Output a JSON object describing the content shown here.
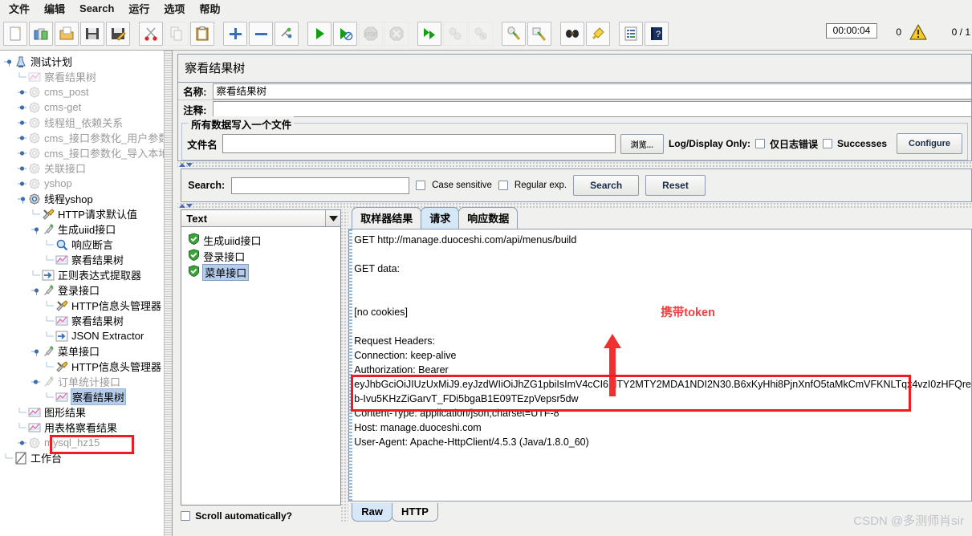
{
  "menu": {
    "items": [
      {
        "label": "文件",
        "name": "menu-file"
      },
      {
        "label": "编辑",
        "name": "menu-edit"
      },
      {
        "label": "Search",
        "name": "menu-search"
      },
      {
        "label": "运行",
        "name": "menu-run"
      },
      {
        "label": "选项",
        "name": "menu-options"
      },
      {
        "label": "帮助",
        "name": "menu-help"
      }
    ]
  },
  "toolbar": {
    "icons": [
      {
        "name": "new-icon",
        "group": 1,
        "disabled": false
      },
      {
        "name": "templates-icon",
        "group": 1,
        "disabled": false
      },
      {
        "name": "open-icon",
        "group": 1,
        "disabled": false
      },
      {
        "name": "save-icon",
        "group": 1,
        "disabled": false
      },
      {
        "name": "save-as-icon",
        "group": 1,
        "disabled": false
      },
      {
        "name": "cut-icon",
        "group": 2,
        "disabled": false
      },
      {
        "name": "copy-icon",
        "group": 2,
        "disabled": true
      },
      {
        "name": "paste-icon",
        "group": 2,
        "disabled": false
      },
      {
        "name": "expand-all-icon",
        "group": 3,
        "disabled": false
      },
      {
        "name": "collapse-all-icon",
        "group": 3,
        "disabled": false
      },
      {
        "name": "toggle-icon",
        "group": 3,
        "disabled": false
      },
      {
        "name": "start-icon",
        "group": 4,
        "disabled": false
      },
      {
        "name": "start-no-pause-icon",
        "group": 4,
        "disabled": false
      },
      {
        "name": "stop-icon",
        "group": 4,
        "disabled": true
      },
      {
        "name": "shutdown-icon",
        "group": 4,
        "disabled": true
      },
      {
        "name": "remote-start-all-icon",
        "group": 5,
        "disabled": false
      },
      {
        "name": "remote-stop-all-icon",
        "group": 5,
        "disabled": true
      },
      {
        "name": "remote-shutdown-all-icon",
        "group": 5,
        "disabled": true
      },
      {
        "name": "clear-icon",
        "group": 6,
        "disabled": false
      },
      {
        "name": "clear-all-icon",
        "group": 6,
        "disabled": false
      },
      {
        "name": "search-icon",
        "group": 7,
        "disabled": false
      },
      {
        "name": "search-reset-icon",
        "group": 7,
        "disabled": false
      },
      {
        "name": "function-helper-icon",
        "group": 8,
        "disabled": false
      },
      {
        "name": "help-icon",
        "group": 8,
        "disabled": false
      }
    ],
    "timer": "00:00:04",
    "warn_count": "0",
    "thread_count": "0 / 1"
  },
  "tree": {
    "nodes": [
      {
        "label": "测试计划",
        "indent": 0,
        "icon": "test-plan-icon",
        "handle": "expanded",
        "dim": false
      },
      {
        "label": "察看结果树",
        "indent": 1,
        "icon": "view-results-tree-icon",
        "handle": "leaf",
        "dim": true
      },
      {
        "label": "cms_post",
        "indent": 1,
        "icon": "thread-group-icon",
        "handle": "collapsed",
        "dim": true
      },
      {
        "label": "cms-get",
        "indent": 1,
        "icon": "thread-group-icon",
        "handle": "collapsed",
        "dim": true
      },
      {
        "label": "线程组_依赖关系",
        "indent": 1,
        "icon": "thread-group-icon",
        "handle": "collapsed",
        "dim": true
      },
      {
        "label": "cms_接口参数化_用户参数",
        "indent": 1,
        "icon": "thread-group-icon",
        "handle": "collapsed",
        "dim": true
      },
      {
        "label": "cms_接口参数化_导入本地文件",
        "indent": 1,
        "icon": "thread-group-icon",
        "handle": "collapsed",
        "dim": true
      },
      {
        "label": "关联接口",
        "indent": 1,
        "icon": "thread-group-icon",
        "handle": "collapsed",
        "dim": true
      },
      {
        "label": "yshop",
        "indent": 1,
        "icon": "thread-group-icon",
        "handle": "collapsed",
        "dim": true
      },
      {
        "label": "线程yshop",
        "indent": 1,
        "icon": "thread-group-active-icon",
        "handle": "expanded",
        "dim": false
      },
      {
        "label": "HTTP请求默认值",
        "indent": 2,
        "icon": "http-defaults-icon",
        "handle": "leaf",
        "dim": false
      },
      {
        "label": "生成uiid接口",
        "indent": 2,
        "icon": "http-sampler-icon",
        "handle": "expanded",
        "dim": false
      },
      {
        "label": "响应断言",
        "indent": 3,
        "icon": "assertion-icon",
        "handle": "leaf",
        "dim": false
      },
      {
        "label": "察看结果树",
        "indent": 3,
        "icon": "view-results-tree-icon",
        "handle": "leaf",
        "dim": false
      },
      {
        "label": "正则表达式提取器",
        "indent": 2,
        "icon": "regex-extractor-icon",
        "handle": "leaf",
        "dim": false
      },
      {
        "label": "登录接口",
        "indent": 2,
        "icon": "http-sampler-icon",
        "handle": "expanded",
        "dim": false
      },
      {
        "label": "HTTP信息头管理器",
        "indent": 3,
        "icon": "http-header-manager-icon",
        "handle": "leaf",
        "dim": false
      },
      {
        "label": "察看结果树",
        "indent": 3,
        "icon": "view-results-tree-icon",
        "handle": "leaf",
        "dim": false
      },
      {
        "label": "JSON Extractor",
        "indent": 3,
        "icon": "regex-extractor-icon",
        "handle": "leaf",
        "dim": false
      },
      {
        "label": "菜单接口",
        "indent": 2,
        "icon": "http-sampler-icon",
        "handle": "expanded",
        "dim": false
      },
      {
        "label": "HTTP信息头管理器",
        "indent": 3,
        "icon": "http-header-manager-icon",
        "handle": "leaf",
        "dim": false
      },
      {
        "label": "订单统计接口",
        "indent": 2,
        "icon": "http-sampler-icon",
        "handle": "collapsed",
        "dim": true
      },
      {
        "label": "察看结果树",
        "indent": 3,
        "icon": "view-results-tree-icon",
        "handle": "leaf",
        "dim": false,
        "selected": true
      },
      {
        "label": "图形结果",
        "indent": 1,
        "icon": "view-results-tree-icon",
        "handle": "leaf",
        "dim": false
      },
      {
        "label": "用表格察看结果",
        "indent": 1,
        "icon": "view-results-tree-icon",
        "handle": "leaf",
        "dim": false
      },
      {
        "label": "mysql_hz15",
        "indent": 1,
        "icon": "thread-group-icon",
        "handle": "collapsed",
        "dim": true
      },
      {
        "label": "工作台",
        "indent": 0,
        "icon": "workbench-icon",
        "handle": "leaf",
        "dim": false
      }
    ]
  },
  "panel": {
    "title": "察看结果树",
    "name_label": "名称:",
    "name_value": "察看结果树",
    "comment_label": "注释:",
    "comment_value": "",
    "group_title": "所有数据写入一个文件",
    "filename_label": "文件名",
    "filename_value": "",
    "browse_button": "浏览...",
    "log_display_label": "Log/Display Only:",
    "errors_only_label": "仅日志错误",
    "successes_label": "Successes",
    "configure_button": "Configure"
  },
  "search": {
    "label": "Search:",
    "value": "",
    "case_sensitive_label": "Case sensitive",
    "regular_exp_label": "Regular exp.",
    "search_button": "Search",
    "reset_button": "Reset"
  },
  "results": {
    "render_selected": "Text",
    "items": [
      {
        "label": "生成uiid接口",
        "status": "success",
        "selected": false
      },
      {
        "label": "登录接口",
        "status": "success",
        "selected": false
      },
      {
        "label": "菜单接口",
        "status": "success",
        "selected": true
      }
    ],
    "scroll_label": "Scroll automatically?"
  },
  "detail": {
    "tabs": [
      {
        "label": "取样器结果",
        "active": false
      },
      {
        "label": "请求",
        "active": true
      },
      {
        "label": "响应数据",
        "active": false
      }
    ],
    "bottom_tabs": [
      {
        "label": "Raw",
        "active": true
      },
      {
        "label": "HTTP",
        "active": false
      }
    ],
    "lines": [
      "GET http://manage.duoceshi.com/api/menus/build",
      "",
      "GET data:",
      "",
      "",
      "[no cookies]",
      "",
      "Request Headers:",
      "Connection: keep-alive",
      "Authorization: Bearer"
    ],
    "token_line_1": "eyJhbGciOiJIUzUxMiJ9.eyJzdWIiOiJhZG1pbiIsImV4cCI6MTY2MTY2MDA1NDI2N30.B6xKyHhi8PjnXnfO5taMkCmVFKNLTqx4vzI0zHFQre",
    "token_line_2": "b-Ivu5KHzZiGarvT_FDi5bgaB1E09TEzpVepsr5dw",
    "lines_after": [
      "Content-Type: application/json;charset=UTF-8",
      "Host: manage.duoceshi.com",
      "User-Agent: Apache-HttpClient/4.5.3 (Java/1.8.0_60)"
    ],
    "annotation": "携带token"
  },
  "watermark": "CSDN @多测师肖sir",
  "colors": {
    "annotation_red": "#f04040",
    "box_red": "#ee1b24",
    "selection_blue": "#b5cdea",
    "tab_active": "#d6e7f8"
  }
}
